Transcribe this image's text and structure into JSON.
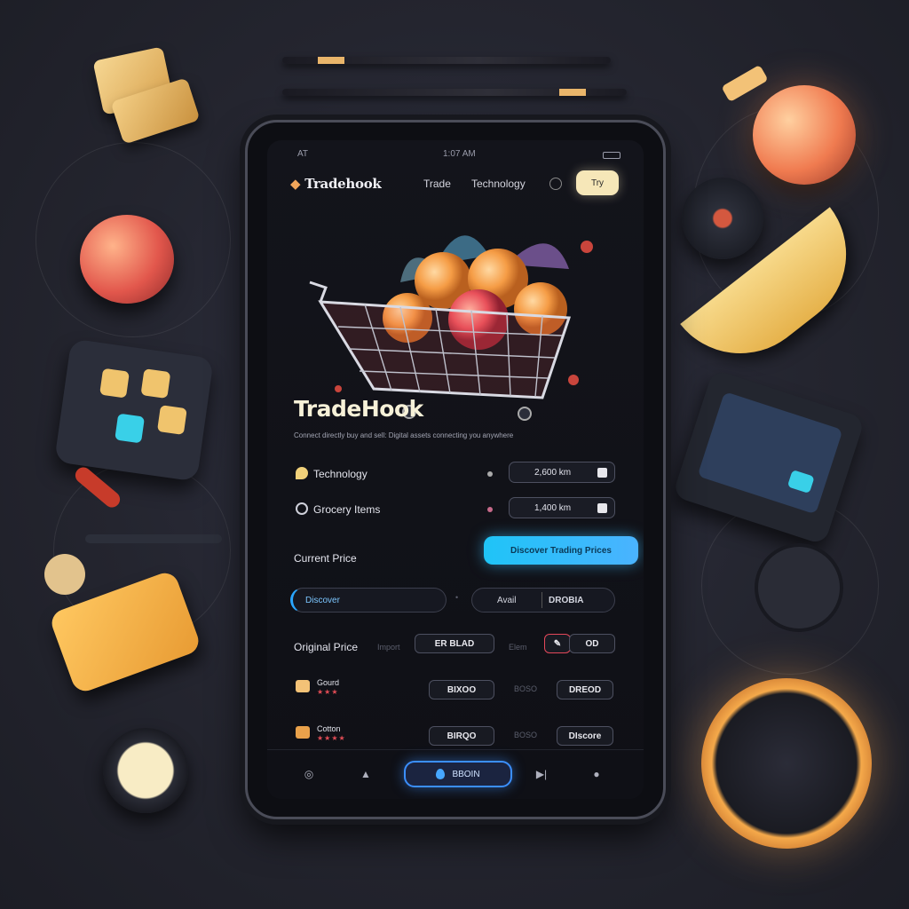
{
  "status_bar": {
    "left": "AT",
    "time": "1:07 AM"
  },
  "nav": {
    "brand": "Tradehook",
    "links": [
      "Trade",
      "Technology"
    ],
    "button_label": "Try"
  },
  "hero": {
    "title": "TradeHook",
    "description": "Connect directly buy and sell: Digital assets connecting you anywhere"
  },
  "market_rows": [
    {
      "label": "Technology",
      "value": "2,600 km"
    },
    {
      "label": "Grocery Items",
      "value": "1,400 km"
    }
  ],
  "current_price": {
    "label": "Current Price",
    "cta_label": "Discover Trading Prices",
    "search_placeholder": "Discover",
    "split_left": "Avail",
    "split_right": "DROBIA"
  },
  "original_price": {
    "label": "Original Price",
    "faint_left": "Import",
    "tag_1": "ER BLAD",
    "faint_mid": "Elem",
    "tag_2": "OD"
  },
  "list": [
    {
      "name": "Gourd",
      "stars": "★★★",
      "tag": "BIXOO",
      "faint": "BOSO",
      "tag2": "DREOD"
    },
    {
      "name": "Cotton",
      "stars": "★★★★",
      "tag": "BIRQO",
      "faint": "BOSO",
      "tag2": "DIscore"
    }
  ],
  "bottom_bar": {
    "main_label": "BBOIN"
  },
  "colors": {
    "accent_blue": "#1fc4f7",
    "brand_orange": "#f2a65a",
    "cream_button": "#f6e7b8",
    "warning_red": "#e4485a"
  }
}
